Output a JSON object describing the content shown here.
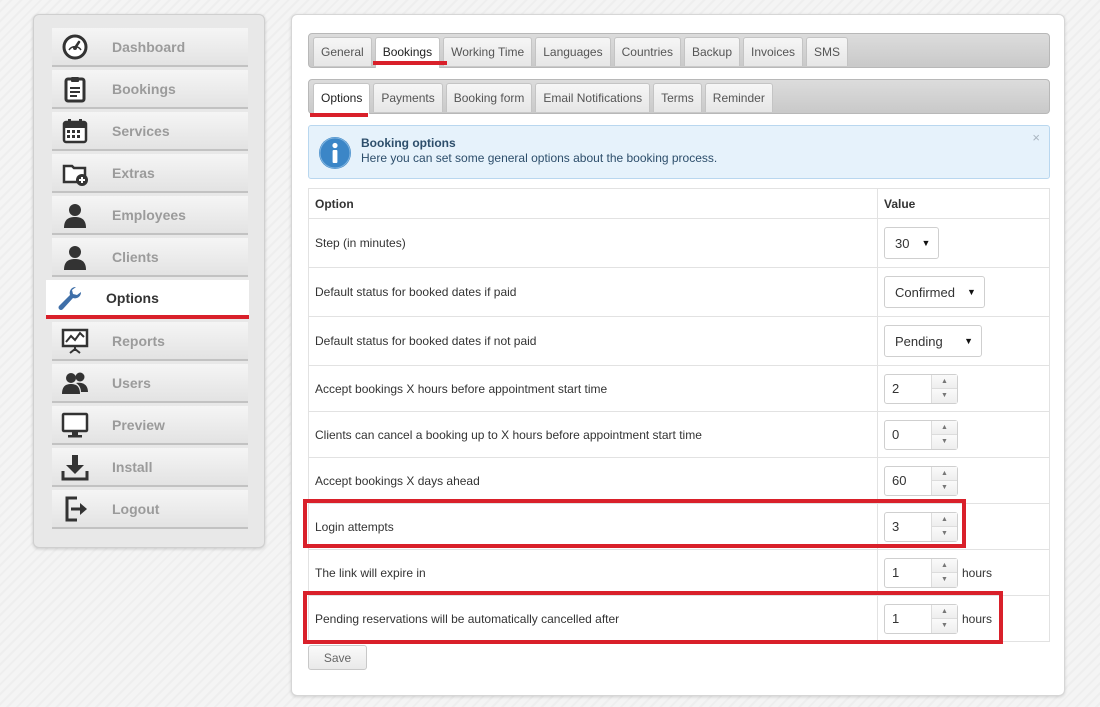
{
  "sidebar": {
    "items": [
      {
        "label": "Dashboard",
        "icon": "dashboard-gauge-icon"
      },
      {
        "label": "Bookings",
        "icon": "clipboard-icon"
      },
      {
        "label": "Services",
        "icon": "calendar-icon"
      },
      {
        "label": "Extras",
        "icon": "folder-plus-icon"
      },
      {
        "label": "Employees",
        "icon": "person-icon"
      },
      {
        "label": "Clients",
        "icon": "person-icon"
      },
      {
        "label": "Options",
        "icon": "wrench-icon",
        "active": true
      },
      {
        "label": "Reports",
        "icon": "presentation-chart-icon"
      },
      {
        "label": "Users",
        "icon": "users-icon"
      },
      {
        "label": "Preview",
        "icon": "monitor-icon"
      },
      {
        "label": "Install",
        "icon": "download-icon"
      },
      {
        "label": "Logout",
        "icon": "logout-icon"
      }
    ]
  },
  "top_tabs": [
    "General",
    "Bookings",
    "Working Time",
    "Languages",
    "Countries",
    "Backup",
    "Invoices",
    "SMS"
  ],
  "top_tabs_active": "Bookings",
  "sub_tabs": [
    "Options",
    "Payments",
    "Booking form",
    "Email Notifications",
    "Terms",
    "Reminder"
  ],
  "sub_tabs_active": "Options",
  "info": {
    "title": "Booking options",
    "text": "Here you can set some general options about the booking process.",
    "close": "×"
  },
  "table": {
    "headers": [
      "Option",
      "Value"
    ],
    "rows": [
      {
        "label": "Step (in minutes)",
        "type": "select",
        "value": "30"
      },
      {
        "label": "Default status for booked dates if paid",
        "type": "select",
        "value": "Confirmed"
      },
      {
        "label": "Default status for booked dates if not paid",
        "type": "select",
        "value": "Pending"
      },
      {
        "label": "Accept bookings X hours before appointment start time",
        "type": "spinner",
        "value": "2",
        "unit": ""
      },
      {
        "label": "Clients can cancel a booking up to X hours before appointment start time",
        "type": "spinner",
        "value": "0",
        "unit": ""
      },
      {
        "label": "Accept bookings X days ahead",
        "type": "spinner",
        "value": "60",
        "unit": ""
      },
      {
        "label": "Login attempts",
        "type": "spinner",
        "value": "3",
        "unit": ""
      },
      {
        "label": "The link will expire in",
        "type": "spinner",
        "value": "1",
        "unit": "hours"
      },
      {
        "label": "Pending reservations will be automatically cancelled after",
        "type": "spinner",
        "value": "1",
        "unit": "hours"
      }
    ]
  },
  "save_label": "Save",
  "colors": {
    "accent_red": "#d9202a",
    "info_bg": "#e6f2fb",
    "info_icon": "#3b86c7"
  }
}
